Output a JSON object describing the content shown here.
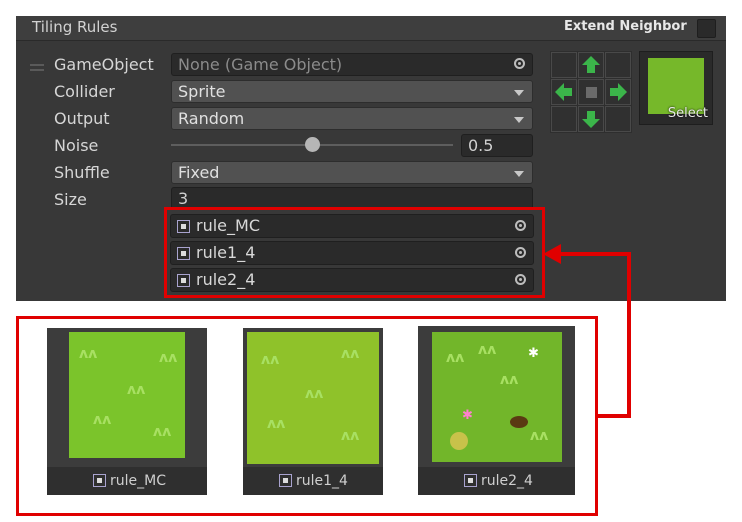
{
  "header": {
    "title": "Tiling Rules",
    "extend_neighbor_label": "Extend Neighbor"
  },
  "rule": {
    "fields": {
      "gameobject": {
        "label": "GameObject",
        "value": "None (Game Object)"
      },
      "collider": {
        "label": "Collider",
        "value": "Sprite"
      },
      "output": {
        "label": "Output",
        "value": "Random"
      },
      "noise": {
        "label": "Noise",
        "value": "0.5",
        "slider_fraction": 0.5
      },
      "shuffle": {
        "label": "Shuffle",
        "value": "Fixed"
      },
      "size": {
        "label": "Size",
        "value": "3"
      }
    },
    "sprites": [
      "rule_MC",
      "rule1_4",
      "rule2_4"
    ],
    "preview": {
      "select_label": "Select"
    }
  },
  "thumbnails": [
    {
      "name": "rule_MC"
    },
    {
      "name": "rule1_4"
    },
    {
      "name": "rule2_4"
    }
  ],
  "colors": {
    "highlight": "#e00000",
    "grass": "#76b82a",
    "arrow": "#3bb54a",
    "panel": "#383838"
  }
}
